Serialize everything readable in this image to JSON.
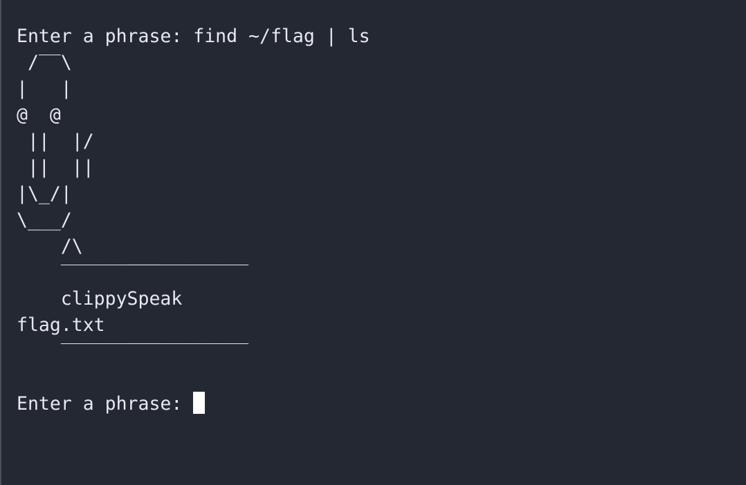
{
  "terminal": {
    "lines": [
      "Enter a phrase: find ~/flag | ls",
      " /‾‾\\",
      "|   |",
      "@  @",
      " ||  |/",
      " ||  ||",
      "|\\_/|",
      "\\___/",
      "    /\\",
      "    ‾‾‾‾‾‾‾‾‾‾‾‾‾‾‾‾‾",
      "    clippySpeak",
      "flag.txt",
      "    ‾‾‾‾‾‾‾‾‾‾‾‾‾‾‾‾‾",
      ""
    ],
    "prompt": "Enter a phrase: "
  }
}
